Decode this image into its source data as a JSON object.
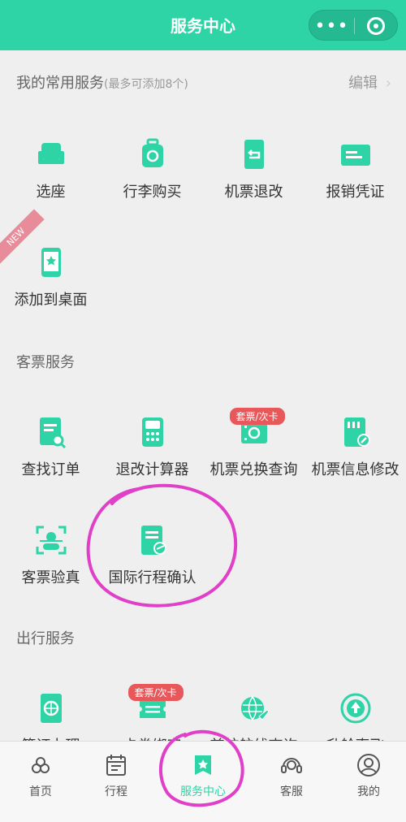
{
  "header": {
    "title": "服务中心",
    "more_icon": "more-dots-icon",
    "close_icon": "target-icon"
  },
  "common": {
    "title": "我的常用服务",
    "subtitle": "(最多可添加8个)",
    "edit_label": "编辑",
    "items": [
      {
        "label": "选座",
        "icon": "seat-icon"
      },
      {
        "label": "行李购买",
        "icon": "luggage-icon"
      },
      {
        "label": "机票退改",
        "icon": "ticket-refund-icon"
      },
      {
        "label": "报销凭证",
        "icon": "receipt-icon"
      },
      {
        "label": "添加到桌面",
        "icon": "phone-star-icon",
        "badge": "NEW"
      }
    ]
  },
  "passenger": {
    "title": "客票服务",
    "items": [
      {
        "label": "查找订单",
        "icon": "order-search-icon"
      },
      {
        "label": "退改计算器",
        "icon": "calculator-icon"
      },
      {
        "label": "机票兑换查询",
        "icon": "ticket-exchange-icon",
        "tag": "套票/次卡"
      },
      {
        "label": "机票信息修改",
        "icon": "ticket-edit-icon"
      },
      {
        "label": "客票验真",
        "icon": "face-scan-icon"
      },
      {
        "label": "国际行程确认",
        "icon": "itinerary-confirm-icon"
      }
    ]
  },
  "travel": {
    "title": "出行服务",
    "items": [
      {
        "label": "签证办理",
        "icon": "passport-icon"
      },
      {
        "label": "卡券绑定",
        "icon": "coupon-icon",
        "tag": "套票/次卡"
      },
      {
        "label": "首航航线查询",
        "icon": "globe-plane-icon"
      },
      {
        "label": "升舱直飞",
        "icon": "upgrade-icon"
      }
    ]
  },
  "tabs": [
    {
      "label": "首页",
      "icon": "home-logo-icon"
    },
    {
      "label": "行程",
      "icon": "calendar-icon"
    },
    {
      "label": "服务中心",
      "icon": "service-icon",
      "active": true
    },
    {
      "label": "客服",
      "icon": "headset-icon"
    },
    {
      "label": "我的",
      "icon": "user-icon"
    }
  ],
  "colors": {
    "brand": "#2ed3a6",
    "tag": "#e8585a",
    "annotation": "#e040c8"
  }
}
